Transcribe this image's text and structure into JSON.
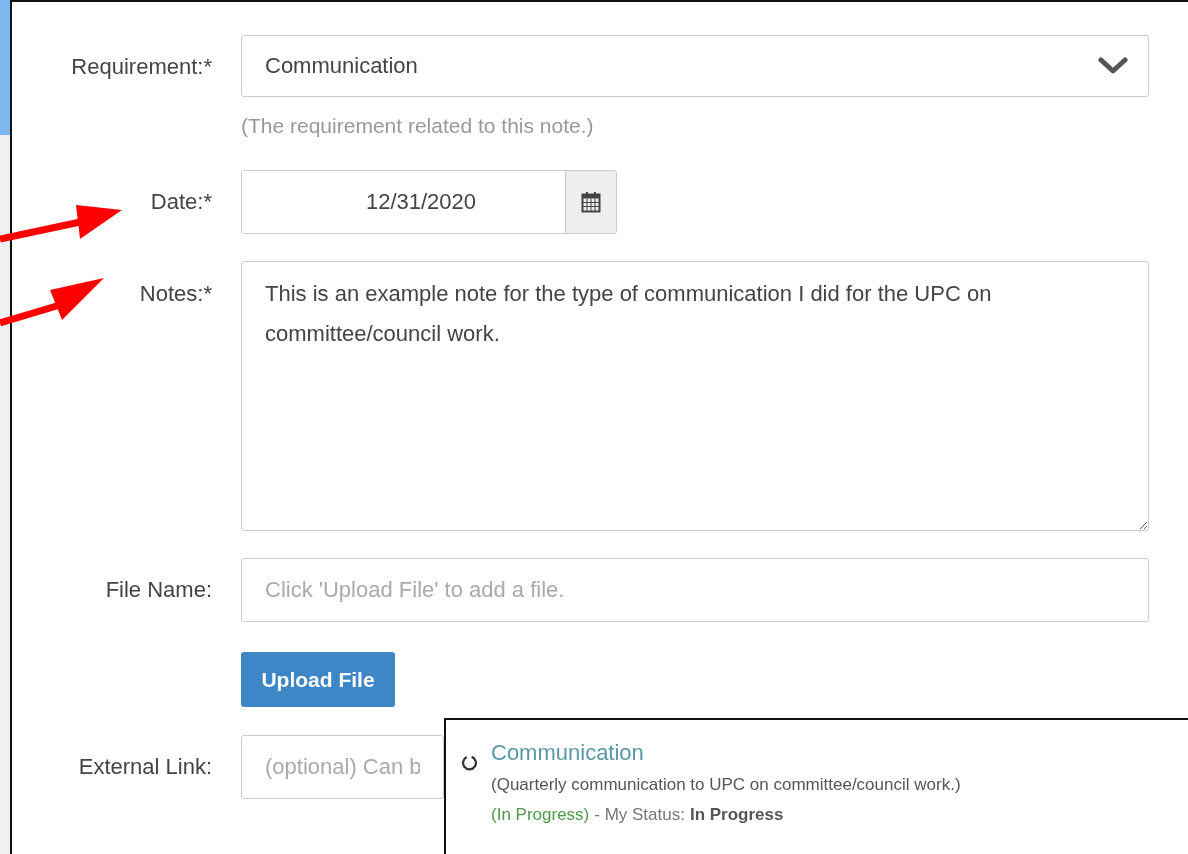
{
  "form": {
    "requirement": {
      "label": "Requirement:*",
      "value": "Communication",
      "help": "(The requirement related to this note.)"
    },
    "date": {
      "label": "Date:*",
      "value": "12/31/2020"
    },
    "notes": {
      "label": "Notes:*",
      "value": "This is an example note for the type of communication I did for the UPC on committee/council work."
    },
    "file_name": {
      "label": "File Name:",
      "placeholder": "Click 'Upload File' to add a file."
    },
    "upload_button": "Upload File",
    "external_link": {
      "label": "External Link:",
      "placeholder": "(optional) Can b"
    }
  },
  "requirement_card": {
    "title": "Communication",
    "description": "(Quarterly communication to UPC on committee/council work.)",
    "status": "(In Progress)",
    "my_status_label": "- My Status:",
    "my_status": "In Progress"
  }
}
